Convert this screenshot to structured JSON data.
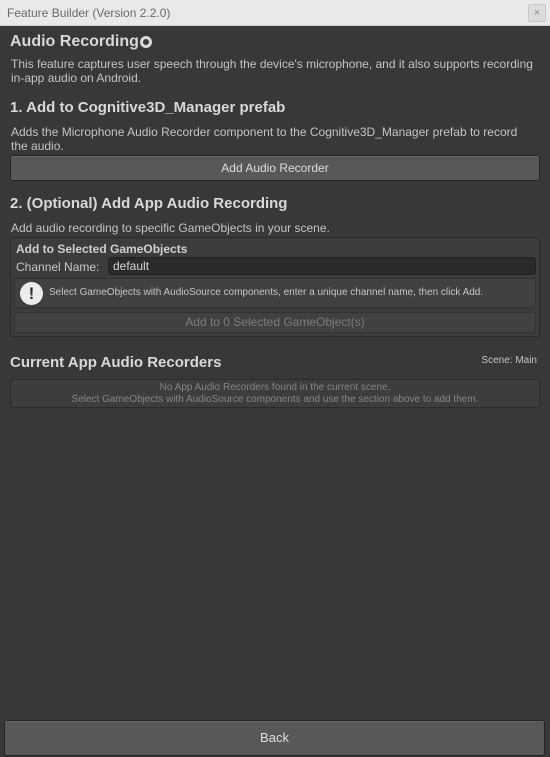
{
  "window": {
    "title": "Feature Builder (Version 2.2.0)",
    "close_glyph": "×"
  },
  "header": {
    "title": "Audio Recording",
    "description": "This feature captures user speech through the device's microphone, and it also supports recording in-app audio on Android."
  },
  "step1": {
    "title": "1. Add to Cognitive3D_Manager prefab",
    "description": "Adds the Microphone Audio Recorder component to the Cognitive3D_Manager prefab to record the audio.",
    "button_label": "Add Audio Recorder"
  },
  "step2": {
    "title": "2. (Optional) Add App Audio Recording",
    "description": "Add audio recording to specific GameObjects in your scene.",
    "group_title": "Add to Selected GameObjects",
    "channel_label": "Channel Name:",
    "channel_value": "default",
    "help_icon_glyph": "!",
    "help_text": "Select GameObjects with AudioSource components, enter a unique channel name, then click Add.",
    "add_button_label": "Add to 0 Selected GameObject(s)"
  },
  "recorders": {
    "title": "Current App Audio Recorders",
    "scene_label": "Scene: Main",
    "empty_line1": "No App Audio Recorders found in the current scene.",
    "empty_line2": "Select GameObjects with AudioSource components and use the section above to add them."
  },
  "footer": {
    "back_label": "Back"
  },
  "icons": {
    "header": "settings-gear-icon",
    "help": "info-icon"
  }
}
